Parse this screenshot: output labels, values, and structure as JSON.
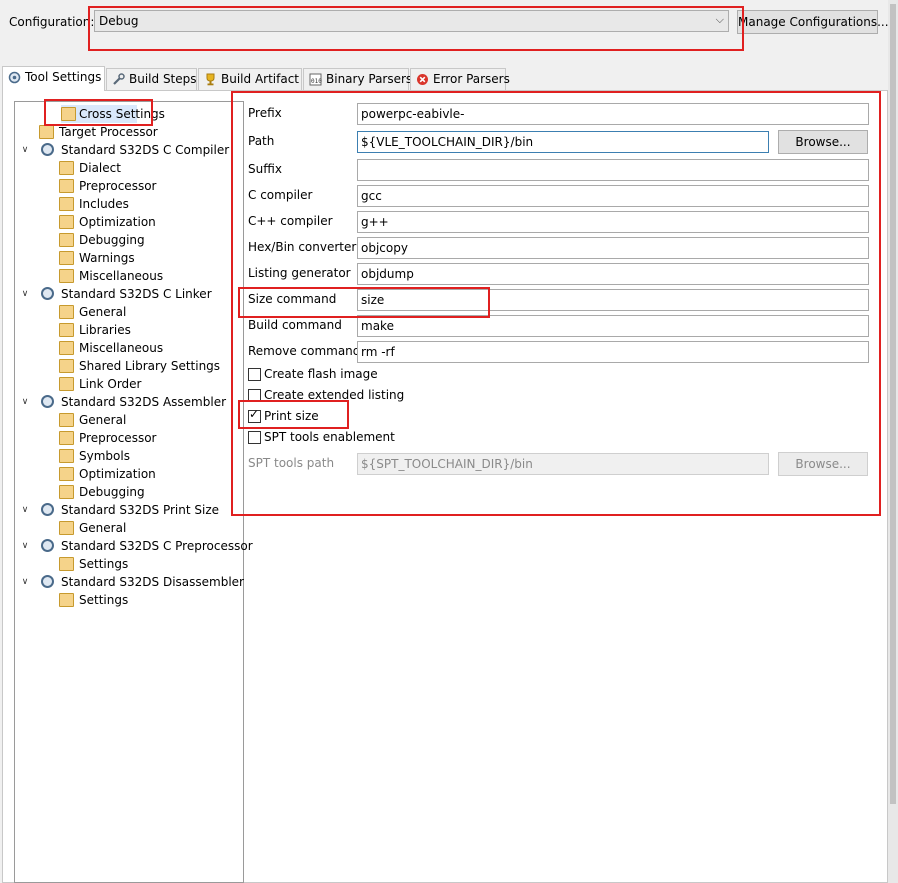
{
  "config": {
    "label": "Configuration:",
    "value": "Debug",
    "manage_button": "Manage Configurations..."
  },
  "tabs": [
    {
      "label": "Tool Settings",
      "icon": "gear-icon"
    },
    {
      "label": "Build Steps",
      "icon": "wrench-icon"
    },
    {
      "label": "Build Artifact",
      "icon": "trophy-icon"
    },
    {
      "label": "Binary Parsers",
      "icon": "binary-icon"
    },
    {
      "label": "Error Parsers",
      "icon": "error-icon"
    }
  ],
  "tree": [
    {
      "label": "Cross Settings",
      "level": 1,
      "icon": "folder-icon",
      "selected": true
    },
    {
      "label": "Target Processor",
      "level": 1,
      "icon": "folder-icon"
    },
    {
      "label": "Standard S32DS C Compiler",
      "level": 0,
      "icon": "gear-icon"
    },
    {
      "label": "Dialect",
      "level": 2,
      "icon": "folder-icon"
    },
    {
      "label": "Preprocessor",
      "level": 2,
      "icon": "folder-icon"
    },
    {
      "label": "Includes",
      "level": 2,
      "icon": "folder-icon"
    },
    {
      "label": "Optimization",
      "level": 2,
      "icon": "folder-icon"
    },
    {
      "label": "Debugging",
      "level": 2,
      "icon": "folder-icon"
    },
    {
      "label": "Warnings",
      "level": 2,
      "icon": "folder-icon"
    },
    {
      "label": "Miscellaneous",
      "level": 2,
      "icon": "folder-icon"
    },
    {
      "label": "Standard S32DS C Linker",
      "level": 0,
      "icon": "gear-icon"
    },
    {
      "label": "General",
      "level": 2,
      "icon": "folder-icon"
    },
    {
      "label": "Libraries",
      "level": 2,
      "icon": "folder-icon"
    },
    {
      "label": "Miscellaneous",
      "level": 2,
      "icon": "folder-icon"
    },
    {
      "label": "Shared Library Settings",
      "level": 2,
      "icon": "folder-icon"
    },
    {
      "label": "Link Order",
      "level": 2,
      "icon": "folder-icon"
    },
    {
      "label": "Standard S32DS Assembler",
      "level": 0,
      "icon": "gear-icon"
    },
    {
      "label": "General",
      "level": 2,
      "icon": "folder-icon"
    },
    {
      "label": "Preprocessor",
      "level": 2,
      "icon": "folder-icon"
    },
    {
      "label": "Symbols",
      "level": 2,
      "icon": "folder-icon"
    },
    {
      "label": "Optimization",
      "level": 2,
      "icon": "folder-icon"
    },
    {
      "label": "Debugging",
      "level": 2,
      "icon": "folder-icon"
    },
    {
      "label": "Standard S32DS Print Size",
      "level": 0,
      "icon": "gear-icon"
    },
    {
      "label": "General",
      "level": 2,
      "icon": "folder-icon"
    },
    {
      "label": "Standard S32DS C Preprocessor",
      "level": 0,
      "icon": "gear-icon"
    },
    {
      "label": "Settings",
      "level": 2,
      "icon": "folder-icon"
    },
    {
      "label": "Standard S32DS Disassembler",
      "level": 0,
      "icon": "gear-icon"
    },
    {
      "label": "Settings",
      "level": 2,
      "icon": "folder-icon"
    }
  ],
  "form": {
    "prefix": {
      "label": "Prefix",
      "value": "powerpc-eabivle-"
    },
    "path": {
      "label": "Path",
      "value": "${VLE_TOOLCHAIN_DIR}/bin",
      "browse": "Browse..."
    },
    "suffix": {
      "label": "Suffix",
      "value": ""
    },
    "c_compiler": {
      "label": "C compiler",
      "value": "gcc"
    },
    "cpp_compiler": {
      "label": "C++ compiler",
      "value": "g++"
    },
    "hexbin": {
      "label": "Hex/Bin converter",
      "value": "objcopy"
    },
    "listing": {
      "label": "Listing generator",
      "value": "objdump"
    },
    "size_cmd": {
      "label": "Size command",
      "value": "size"
    },
    "build_cmd": {
      "label": "Build command",
      "value": "make"
    },
    "remove_cmd": {
      "label": "Remove command",
      "value": "rm -rf"
    },
    "create_flash": {
      "label": "Create flash image",
      "checked": false
    },
    "create_listing": {
      "label": "Create extended listing",
      "checked": false
    },
    "print_size": {
      "label": "Print size",
      "checked": true
    },
    "spt_enable": {
      "label": "SPT tools enablement",
      "checked": false
    },
    "spt_path": {
      "label": "SPT tools path",
      "value": "${SPT_TOOLCHAIN_DIR}/bin",
      "browse": "Browse..."
    }
  },
  "colors": {
    "highlight": "#e02020",
    "selection": "#d9e8fb",
    "focus_border": "#3c7fb1"
  }
}
